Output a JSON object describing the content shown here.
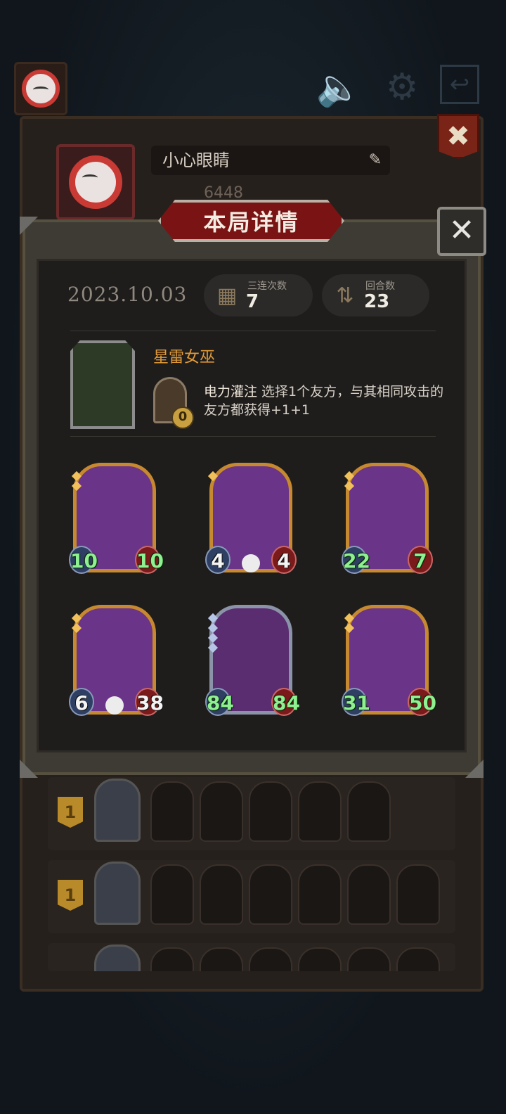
{
  "topbar": {
    "mute_icon": "megaphone-muted-icon",
    "settings_icon": "gear-icon",
    "exit_icon": "exit-door-icon"
  },
  "profile": {
    "name": "小心眼睛",
    "score": "6448",
    "edit_icon": "pencil-icon",
    "close_icon": "close-icon"
  },
  "modal": {
    "title": "本局详情",
    "close_icon": "close-icon",
    "date": "2023.10.03",
    "triples_label": "三连次数",
    "triples_value": "7",
    "rounds_label": "回合数",
    "rounds_value": "23",
    "hero_name": "星雷女巫",
    "skill_cost": "0",
    "skill_name": "电力灌注",
    "skill_desc": " 选择1个友方，与其相同攻击的友方都获得+1+1"
  },
  "cards": [
    {
      "attack": "10",
      "health": "10",
      "gems": 2,
      "frame": "gold",
      "buffed": true
    },
    {
      "attack": "4",
      "health": "4",
      "gems": 1,
      "frame": "gold",
      "buffed": false
    },
    {
      "attack": "22",
      "health": "7",
      "gems": 2,
      "frame": "gold",
      "buffed": true
    },
    {
      "attack": "6",
      "health": "38",
      "gems": 2,
      "frame": "gold",
      "buffed": false
    },
    {
      "attack": "84",
      "health": "84",
      "gems": 4,
      "frame": "silver",
      "buffed": true
    },
    {
      "attack": "31",
      "health": "50",
      "gems": 2,
      "frame": "gold",
      "buffed": true
    }
  ],
  "history": [
    {
      "rank": "1",
      "minions": 5
    },
    {
      "rank": "1",
      "minions": 6
    }
  ]
}
